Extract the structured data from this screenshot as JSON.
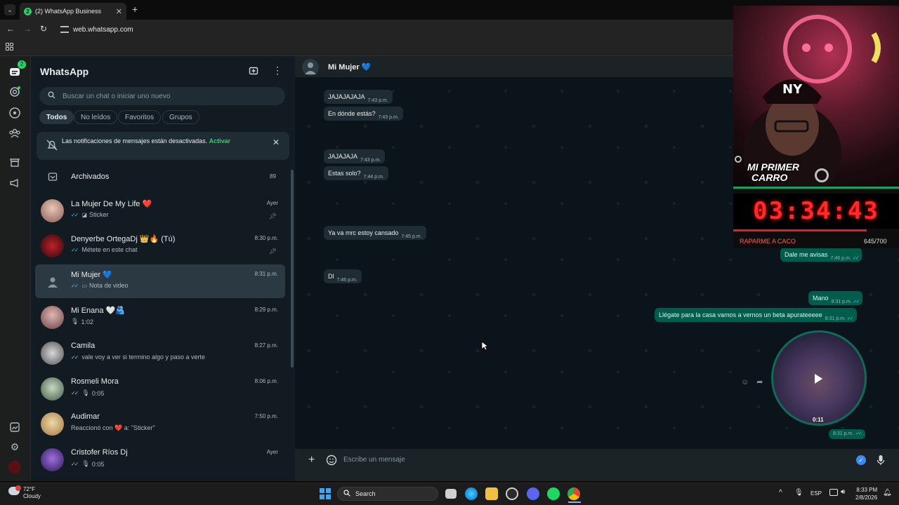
{
  "browser": {
    "tab_title": "(2) WhatsApp Business",
    "tab_favicon_text": "2",
    "url": "web.whatsapp.com"
  },
  "rail": {
    "chats_badge": "2"
  },
  "sidebar": {
    "title": "WhatsApp",
    "search_placeholder": "Buscar un chat o iniciar uno nuevo",
    "filters": [
      "Todos",
      "No leídos",
      "Favoritos",
      "Grupos"
    ],
    "notification": {
      "text": "Las notificaciones de mensajes están desactivadas.",
      "action": "Activar"
    },
    "archived": {
      "label": "Archivados",
      "count": "89"
    },
    "chats": [
      {
        "name": "La Mujer De My Life ❤️",
        "preview": "Sticker",
        "time": "Ayer",
        "pinned": true
      },
      {
        "name": "Denyerbe OrtegaDj 👑🔥 (Tú)",
        "preview": "Métete en este chat",
        "time": "8:30 p.m.",
        "pinned": true
      },
      {
        "name": "Mi Mujer 💙",
        "preview": "Nota de video",
        "time": "8:31 p.m.",
        "selected": true
      },
      {
        "name": "Mi Enana 🤍🫂",
        "preview": "1:02",
        "time": "8:29 p.m."
      },
      {
        "name": "Camila",
        "preview": "vale voy a ver si termino algo y paso a verte",
        "time": "8:27 p.m."
      },
      {
        "name": "Rosmeli Mora",
        "preview": "0:05",
        "time": "8:06 p.m."
      },
      {
        "name": "Audimar",
        "preview": "Reaccionó con ❤️ a: \"Sticker\"",
        "time": "7:50 p.m."
      },
      {
        "name": "Cristofer Ríos Dj",
        "preview": "0:05",
        "time": "Ayer"
      }
    ]
  },
  "conversation": {
    "contact_name": "Mi Mujer 💙",
    "messages": [
      {
        "dir": "in",
        "text": "JAJAJAJAJA",
        "time": "7:43 p.m."
      },
      {
        "dir": "in",
        "text": "En dónde estás?",
        "time": "7:43 p.m."
      },
      {
        "dir": "in",
        "text": "JAJAJAJA",
        "time": "7:43 p.m."
      },
      {
        "dir": "in",
        "text": "Estas solo?",
        "time": "7:44 p.m."
      },
      {
        "dir": "in",
        "text": "Ya va mrc estoy cansado",
        "time": "7:45 p.m."
      },
      {
        "dir": "in",
        "text": "Dl",
        "time": "7:46 p.m."
      },
      {
        "dir": "out",
        "text": "Dale me avisas",
        "time": "7:46 p.m."
      },
      {
        "dir": "out",
        "text": "Mano",
        "time": "8:31 p.m."
      },
      {
        "dir": "out",
        "text": "Llégate para la casa vamos a vernos un beta apurateeeee",
        "time": "8:31 p.m."
      }
    ],
    "video_note": {
      "duration": "0:11",
      "time": "8:31 p.m."
    },
    "composer_placeholder": "Escribe un mensaje"
  },
  "overlay": {
    "title_line1": "MI PRIMER",
    "title_line2": "CARRO",
    "timer": "03:34:43",
    "goal_label": "RAPARME A CACO",
    "goal_count": "645/700"
  },
  "taskbar": {
    "weather_temp": "72°F",
    "weather_desc": "Cloudy",
    "search_label": "Search",
    "language": "ESP",
    "time": "8:33 PM",
    "date": "2/8/2026"
  },
  "colors": {
    "accent": "#25d366",
    "outgoing_bubble": "#005c4b",
    "incoming_bubble": "#202c33",
    "read_tick": "#53bdeb",
    "timer_red": "#ff2a2a"
  }
}
